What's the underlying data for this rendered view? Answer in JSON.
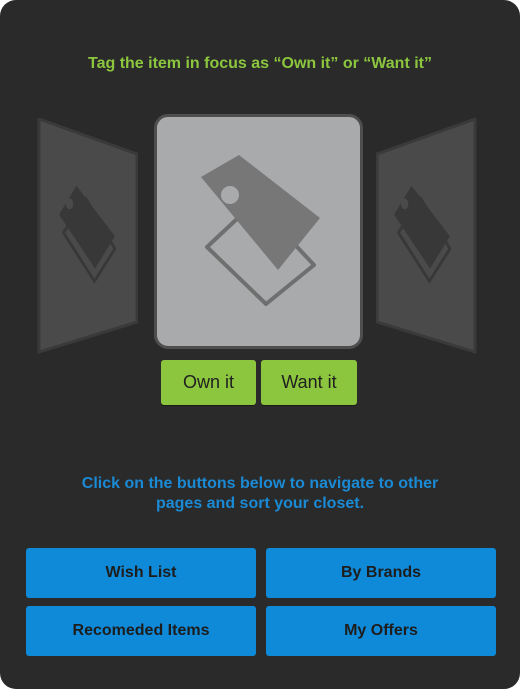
{
  "headline": "Tag the item in focus as “Own it” or “Want it”",
  "carousel": {
    "left_icon": "price-tag-icon",
    "center_icon": "price-tag-icon",
    "right_icon": "price-tag-icon"
  },
  "tag_buttons": {
    "own": "Own it",
    "want": "Want it"
  },
  "instructions": "Click on the buttons below to navigate to other pages and sort your closet.",
  "nav": {
    "wish_list": "Wish List",
    "by_brands": "By Brands",
    "recommended": "Recomeded Items",
    "my_offers": "My Offers"
  },
  "colors": {
    "background": "#2a2a2a",
    "accent_green": "#8cc63f",
    "accent_blue": "#0f8ad8",
    "card_gray": "#a8aaac"
  }
}
